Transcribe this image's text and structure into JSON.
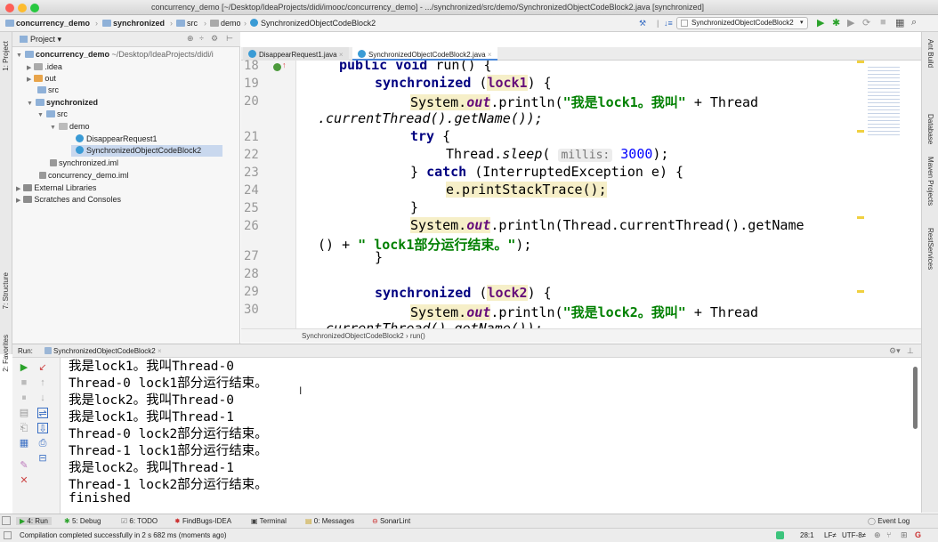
{
  "window": {
    "title": "concurrency_demo [~/Desktop/IdeaProjects/didi/imooc/concurrency_demo] - .../synchronized/src/demo/SynchronizedObjectCodeBlock2.java [synchronized]"
  },
  "navbar": {
    "breadcrumbs": [
      "concurrency_demo",
      "synchronized",
      "src",
      "demo",
      "SynchronizedObjectCodeBlock2"
    ],
    "run_config": "SynchronizedObjectCodeBlock2"
  },
  "sidebar_left": {
    "project_tab": "1: Project",
    "structure_tab": "7: Structure",
    "favorites_tab": "2: Favorites"
  },
  "sidebar_right": {
    "tabs": [
      "Ant Build",
      "Database",
      "Maven Projects",
      "RestServices"
    ]
  },
  "project": {
    "header_label": "Project",
    "tree": [
      {
        "label": "concurrency_demo",
        "suffix": "~/Desktop/IdeaProjects/didi/i"
      },
      {
        "label": ".idea"
      },
      {
        "label": "out"
      },
      {
        "label": "src"
      },
      {
        "label": "synchronized"
      },
      {
        "label": "src"
      },
      {
        "label": "demo"
      },
      {
        "label": "DisappearRequest1"
      },
      {
        "label": "SynchronizedObjectCodeBlock2"
      },
      {
        "label": "synchronized.iml"
      },
      {
        "label": "concurrency_demo.iml"
      },
      {
        "label": "External Libraries"
      },
      {
        "label": "Scratches and Consoles"
      }
    ]
  },
  "editor": {
    "tabs": [
      "DisappearRequest1.java",
      "SynchronizedObjectCodeBlock2.java"
    ],
    "line_numbers": [
      "18",
      "19",
      "20",
      "21",
      "22",
      "23",
      "24",
      "25",
      "26",
      "27",
      "28",
      "29",
      "30"
    ],
    "breadcrumb": [
      "SynchronizedObjectCodeBlock2",
      "run()"
    ],
    "code": {
      "l18_kw": "public void",
      "l18_rest": " run() {",
      "l19_kw": "synchronized",
      "l19_lock": "lock1",
      "l19_rest": ") {",
      "l20_sys": "System.",
      "l20_out": "out",
      "l20_print": ".println(",
      "l20_str": "\"我是lock1。我叫\"",
      "l20_rest": " + Thread",
      "l20b": ".currentThread().getName());",
      "l21_kw": "try",
      "l21_rest": " {",
      "l22_a": "Thread.",
      "l22_sleep": "sleep",
      "l22_b": "( ",
      "l22_hint": "millis:",
      "l22_num": "3000",
      "l22_c": ");",
      "l23_a": "} ",
      "l23_kw": "catch",
      "l23_b": " (InterruptedException e) {",
      "l24": "e.printStackTrace();",
      "l25": "}",
      "l26_sys": "System.",
      "l26_out": "out",
      "l26_rest": ".println(Thread.currentThread().getName",
      "l26b_a": "() + ",
      "l26b_str": "\" lock1部分运行结束。\"",
      "l26b_c": ");",
      "l27": "}",
      "l29_kw": "synchronized",
      "l29_lock": "lock2",
      "l29_rest": ") {",
      "l30_sys": "System.",
      "l30_out": "out",
      "l30_print": ".println(",
      "l30_str": "\"我是lock2。我叫\"",
      "l30_rest": " + Thread",
      "l30b": ".currentThread().getName());"
    }
  },
  "run": {
    "label": "Run:",
    "tab": "SynchronizedObjectCodeBlock2",
    "output": [
      "我是lock1。我叫Thread-0",
      "Thread-0 lock1部分运行结束。",
      "我是lock2。我叫Thread-0",
      "我是lock1。我叫Thread-1",
      "Thread-0 lock2部分运行结束。",
      "Thread-1 lock1部分运行结束。",
      "我是lock2。我叫Thread-1",
      "Thread-1 lock2部分运行结束。",
      "finished"
    ]
  },
  "bottom_tabs": [
    "4: Run",
    "5: Debug",
    "6: TODO",
    "FindBugs-IDEA",
    "Terminal",
    "0: Messages",
    "SonarLint"
  ],
  "event_log": "Event Log",
  "status": {
    "message": "Compilation completed successfully in 2 s 682 ms (moments ago)",
    "position": "28:1",
    "line_sep": "LF≠",
    "encoding": "UTF-8≠"
  }
}
